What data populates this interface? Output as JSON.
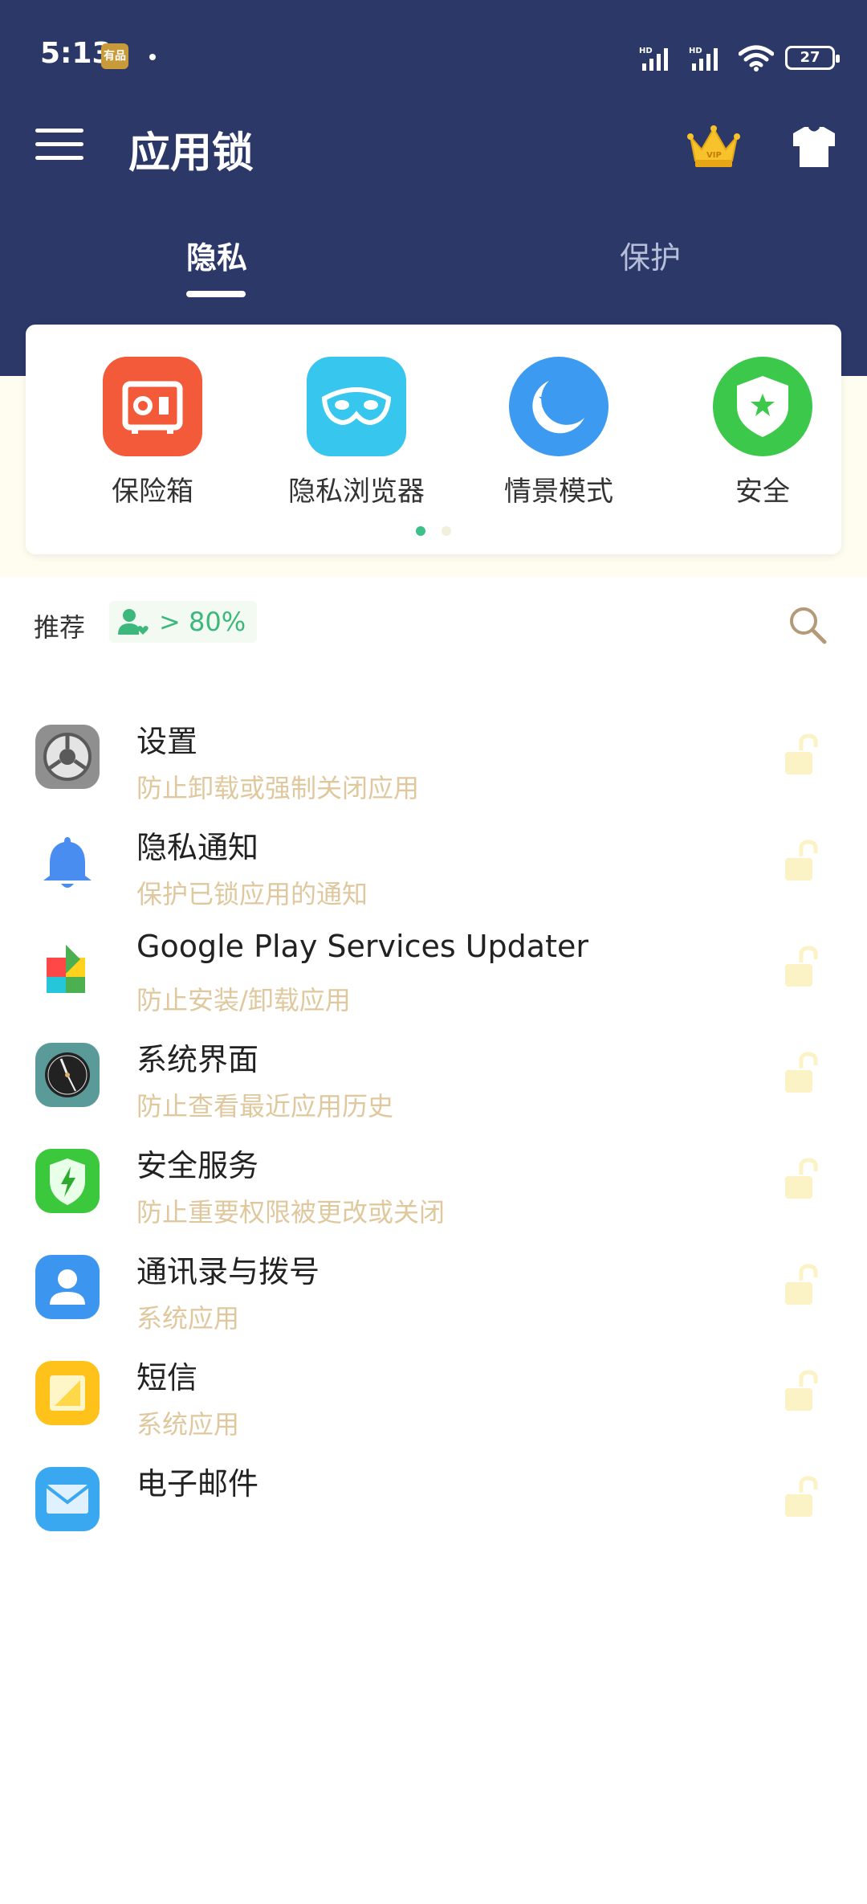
{
  "status_bar": {
    "time": "5:13",
    "badge": "有品",
    "battery": "27"
  },
  "toolbar": {
    "title": "应用锁",
    "menu_icon": "menu-icon",
    "vip_icon": "crown-icon",
    "theme_icon": "shirt-icon"
  },
  "tabs": [
    {
      "label": "隐私",
      "active": true
    },
    {
      "label": "保护",
      "active": false
    }
  ],
  "features": [
    {
      "label": "保险箱",
      "icon": "vault-icon",
      "color": "#f25a3a"
    },
    {
      "label": "隐私浏览器",
      "icon": "mask-icon",
      "color": "#36c6ee"
    },
    {
      "label": "情景模式",
      "icon": "moon-icon",
      "color": "#3c9af0"
    },
    {
      "label": "安全",
      "icon": "shield-icon",
      "color": "#3cc84a"
    }
  ],
  "recommend": {
    "label": "推荐",
    "badge": "> 80%"
  },
  "apps": [
    {
      "name": "设置",
      "desc": "防止卸载或强制关闭应用",
      "icon": "settings-icon"
    },
    {
      "name": "隐私通知",
      "desc": "保护已锁应用的通知",
      "icon": "bell-icon"
    },
    {
      "name": "Google Play Services Updater",
      "desc": "防止安装/卸载应用",
      "icon": "play-services-icon"
    },
    {
      "name": "系统界面",
      "desc": "防止查看最近应用历史",
      "icon": "system-ui-icon"
    },
    {
      "name": "安全服务",
      "desc": "防止重要权限被更改或关闭",
      "icon": "security-service-icon"
    },
    {
      "name": "通讯录与拨号",
      "desc": "系统应用",
      "icon": "contacts-icon"
    },
    {
      "name": "短信",
      "desc": "系统应用",
      "icon": "sms-icon"
    },
    {
      "name": "电子邮件",
      "desc": "",
      "icon": "email-icon"
    }
  ],
  "colors": {
    "header": "#2b3868",
    "accent": "#3cb87c",
    "desc_text": "#e0c89e",
    "lock": "#fbf3c6"
  }
}
